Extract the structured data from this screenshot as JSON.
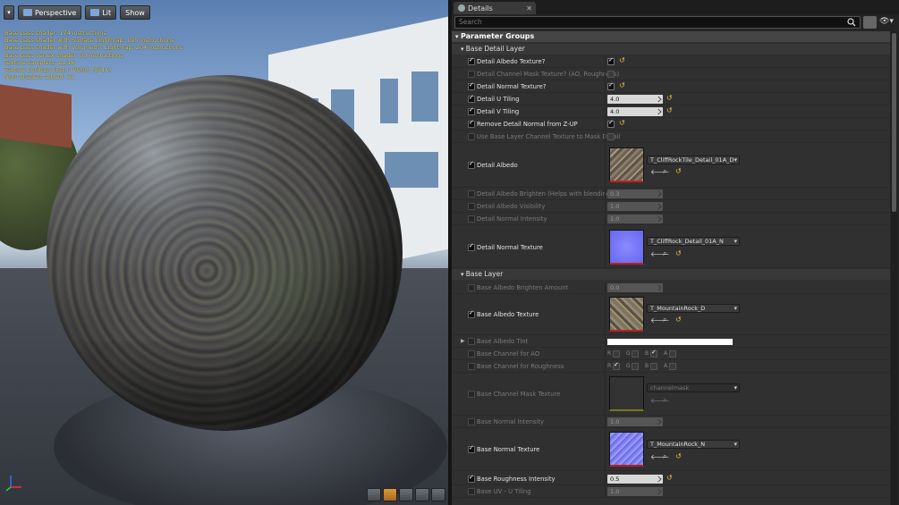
{
  "viewport": {
    "perspective_label": "Perspective",
    "lit_label": "Lit",
    "show_label": "Show",
    "stats": [
      "Base pass shader: 174 instructions",
      "Base pass shader with Surface Lightmap: 195 instructions",
      "Base pass shader with Volumetric Lightmap: 204 instructions",
      "Base pass vertex shader: 39 instructions",
      "Texture samplers: 11/16",
      "Texture Lookups (Est.): VS(0), PS(11)",
      "Num shaders added: 31"
    ]
  },
  "details": {
    "tab_label": "Details",
    "search_placeholder": "Search",
    "parameter_groups_label": "Parameter Groups",
    "sections": {
      "base_detail": "Base Detail Layer",
      "base": "Base Layer"
    },
    "rows": {
      "detail_albedo_texture_q": "Detail Albedo Texture?",
      "detail_channel_mask": "Detail Channel Mask Texture? (AO, Roughness)",
      "detail_normal_texture_q": "Detail Normal Texture?",
      "detail_u_tiling": "Detail U Tiling",
      "detail_u_tiling_value": "4.0",
      "detail_v_tiling": "Detail V Tiling",
      "detail_v_tiling_value": "4.0",
      "remove_detail_normal": "Remove Detail Normal from Z-UP",
      "use_base_layer_channel": "Use Base Layer Channel Texture to Mask Detail",
      "detail_albedo": "Detail Albedo",
      "detail_albedo_asset": "T_CliffRockTile_Detail_01A_D",
      "detail_albedo_brighten": "Detail Albedo Brighten (Helps with blending)",
      "detail_albedo_brighten_value": "0.3",
      "detail_albedo_visibility": "Detail Albedo Visibility",
      "detail_albedo_visibility_value": "1.0",
      "detail_normal_intensity": "Detail Normal Intensity",
      "detail_normal_intensity_value": "1.0",
      "detail_normal_texture": "Detail Normal Texture",
      "detail_normal_asset": "T_CliffRock_Detail_01A_N",
      "base_albedo_brighten": "Base Albedo Brighten Amount",
      "base_albedo_brighten_value": "0.0",
      "base_albedo_texture": "Base Albedo Texture",
      "base_albedo_asset": "T_MountainRock_D",
      "base_albedo_tint": "Base Albedo Tint",
      "base_channel_ao": "Base Channel for AO",
      "base_channel_roughness": "Base Channel for Roughness",
      "base_channel_mask": "Base Channel Mask Texture",
      "base_channel_mask_asset": "channelmask",
      "base_normal_intensity": "Base Normal Intensity",
      "base_normal_intensity_value": "1.0",
      "base_normal_texture": "Base Normal Texture",
      "base_normal_asset": "T_MountainRock_N",
      "base_roughness_intensity": "Base Roughness Intensity",
      "base_roughness_intensity_value": "0.5",
      "base_uv_u_tiling": "Base UV - U Tiling",
      "base_uv_u_tiling_value": "1.0"
    },
    "channels": {
      "r": "R",
      "g": "G",
      "b": "B",
      "a": "A"
    }
  },
  "colors": {
    "accent_yellow": "#e5c24a",
    "stats_yellow": "#e8d24a",
    "panel_bg": "#303030"
  }
}
